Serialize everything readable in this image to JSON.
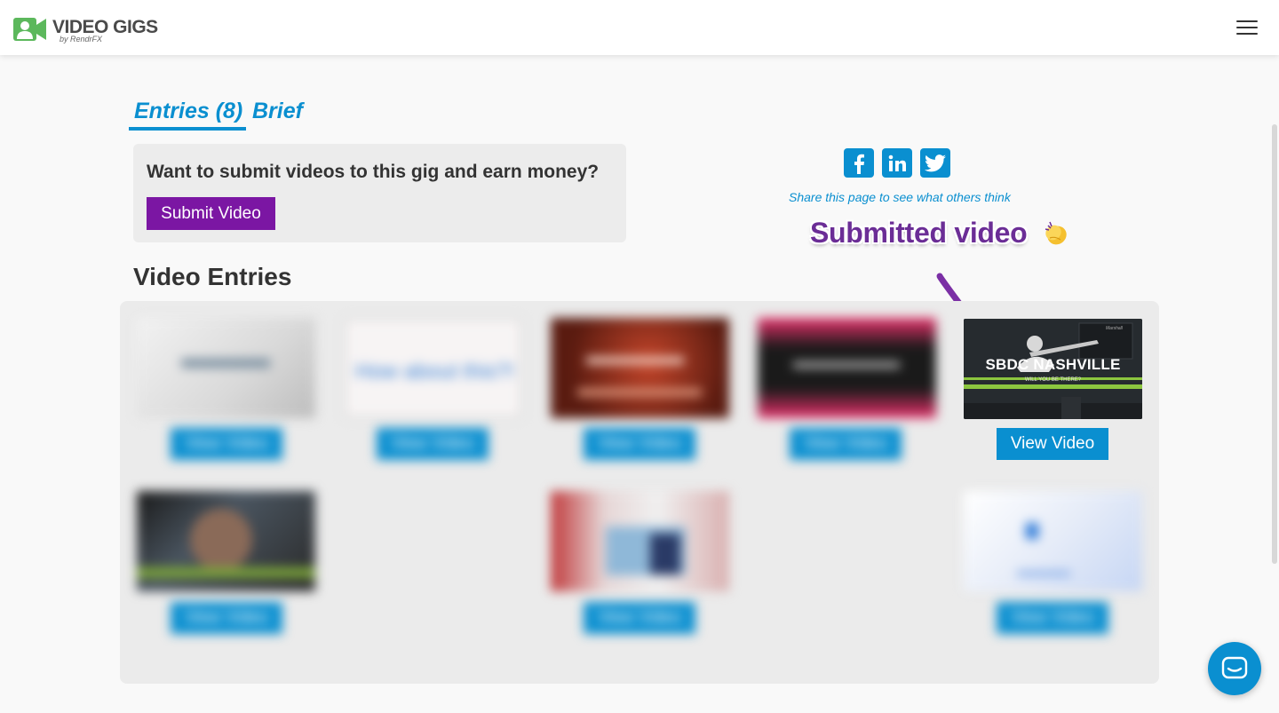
{
  "header": {
    "brand_title": "VIDEO GIGS",
    "brand_sub": "by RendrFX",
    "menu_icon": "hamburger-icon"
  },
  "tabs": [
    {
      "label": "Entries (8)",
      "active": true
    },
    {
      "label": "Brief",
      "active": false
    }
  ],
  "submit_box": {
    "question": "Want to submit videos to this gig and earn money?",
    "button_label": "Submit Video"
  },
  "social": {
    "icons": [
      "facebook-icon",
      "linkedin-icon",
      "twitter-icon"
    ],
    "share_text": "Share this page to see what others think"
  },
  "annotation": {
    "label": "Submitted video",
    "emoji": "clapping-hands-icon"
  },
  "entries": {
    "title": "Video Entries",
    "button_label": "View Video",
    "featured": {
      "thumbnail_title": "SBDC NASHVILLE",
      "thumbnail_sub": "WILL YOU BE THERE?",
      "thumbnail_brand": "Marshall"
    },
    "blurred_text": "How about this?!"
  },
  "colors": {
    "accent_blue": "#0a8fd0",
    "purple": "#7b16a3",
    "annotation_purple": "#6b2d96",
    "logo_green": "#5cb85c"
  }
}
